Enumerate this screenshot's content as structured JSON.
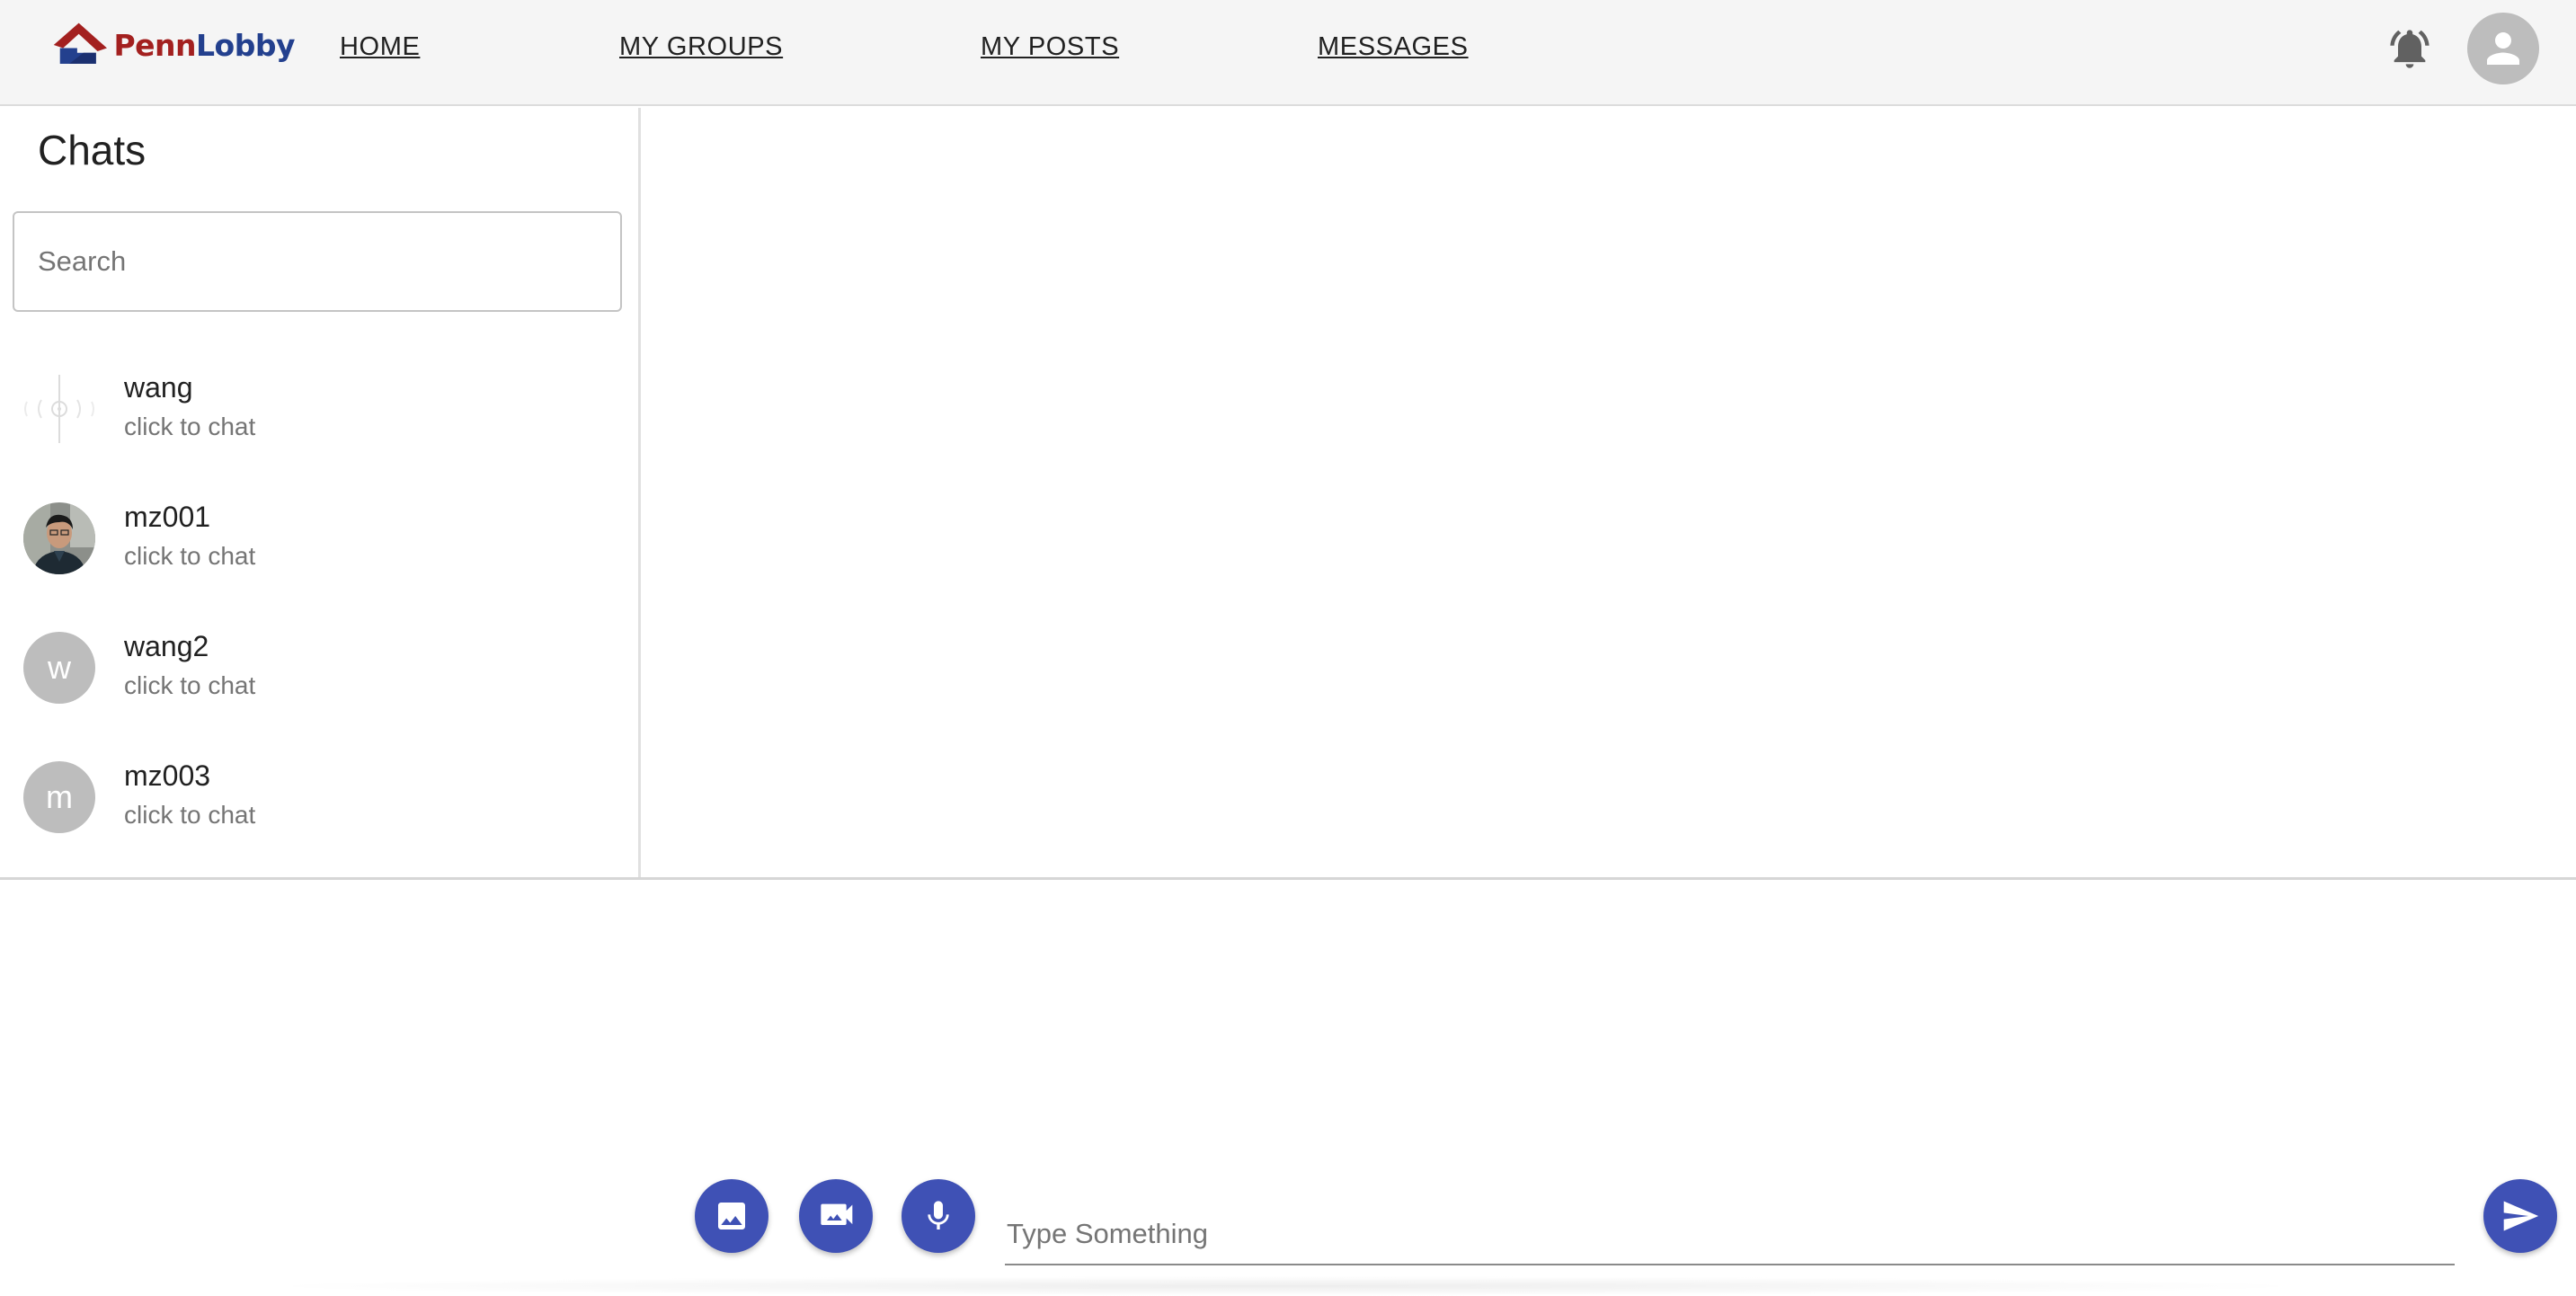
{
  "header": {
    "logo": {
      "part1": "Penn",
      "part2": "Lobby"
    },
    "nav": [
      {
        "label": "HOME"
      },
      {
        "label": "MY GROUPS"
      },
      {
        "label": "MY POSTS"
      },
      {
        "label": "MESSAGES"
      }
    ],
    "icons": {
      "notifications": "bell-icon",
      "profile": "account-icon"
    }
  },
  "sidebar": {
    "title": "Chats",
    "search_placeholder": "Search",
    "chats": [
      {
        "name": "wang",
        "subtitle": "click to chat",
        "avatar": "image-placeholder"
      },
      {
        "name": "mz001",
        "subtitle": "click to chat",
        "avatar": "photo"
      },
      {
        "name": "wang2",
        "subtitle": "click to chat",
        "avatar_letter": "w"
      },
      {
        "name": "mz003",
        "subtitle": "click to chat",
        "avatar_letter": "m"
      }
    ]
  },
  "composer": {
    "placeholder": "Type Something",
    "buttons": [
      "image-icon",
      "video-icon",
      "mic-icon",
      "send-icon"
    ]
  },
  "colors": {
    "accent": "#3f51b5",
    "logo_red": "#a3201f",
    "logo_blue": "#23408e",
    "header_bg": "#f5f5f5"
  }
}
